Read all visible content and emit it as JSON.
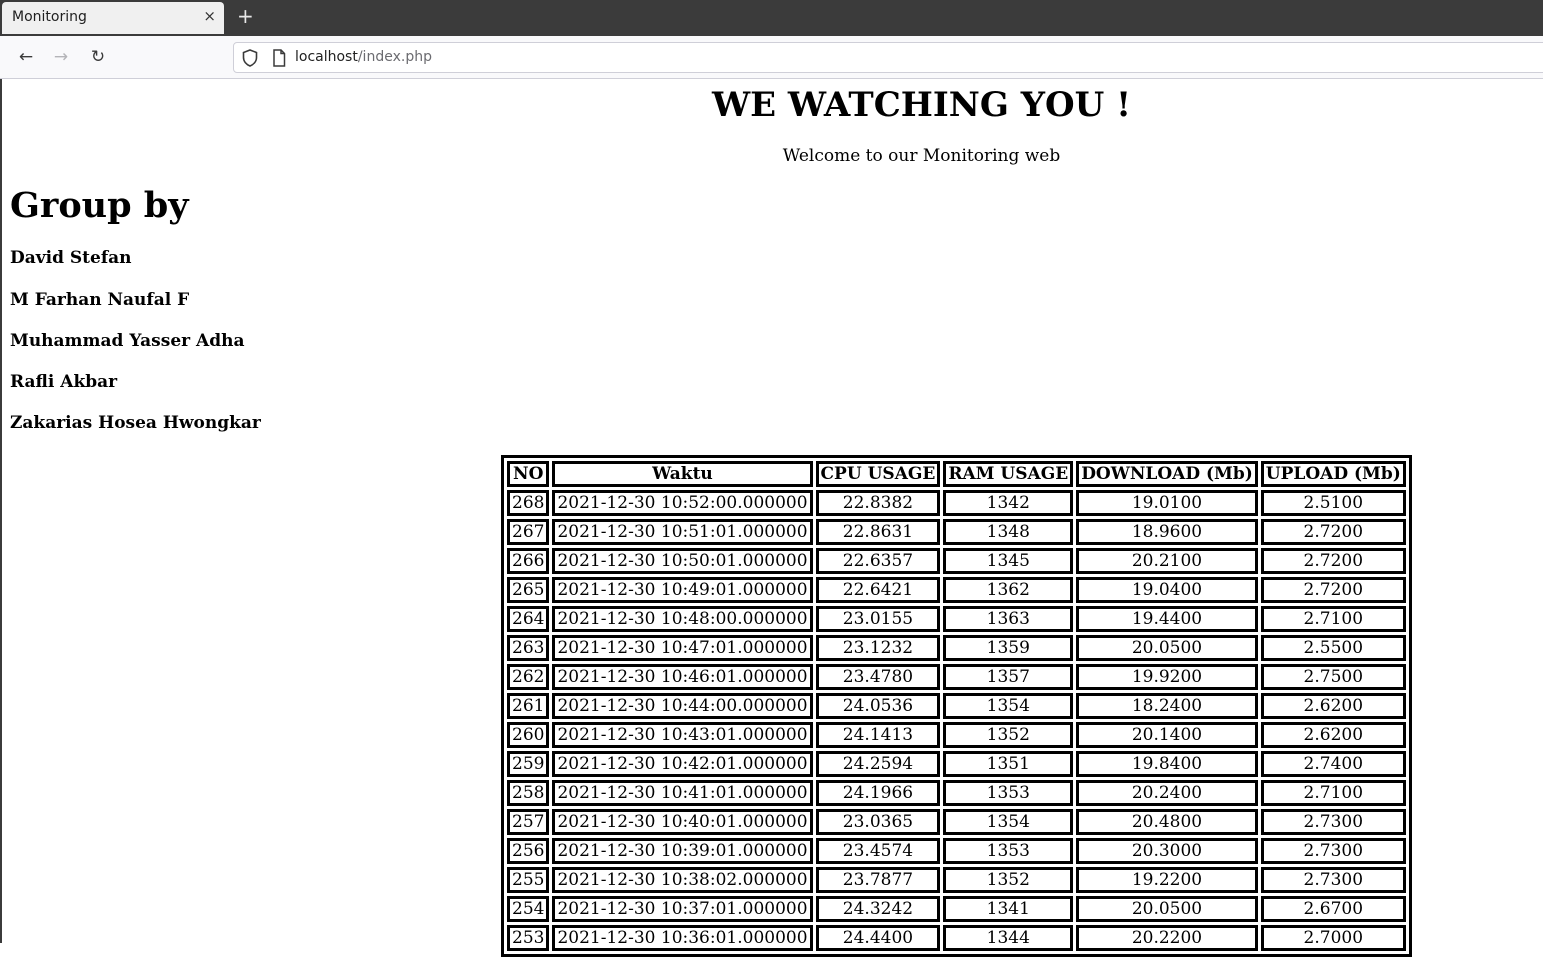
{
  "browser": {
    "tab_title": "Monitoring",
    "tab_close": "×",
    "new_tab": "+",
    "url_host": "localhost",
    "url_path": "/index.php",
    "back": "←",
    "forward": "→",
    "reload": "↻"
  },
  "page": {
    "title": "WE WATCHING YOU !",
    "subtitle": "Welcome to our Monitoring web",
    "group_heading": "Group by",
    "members": [
      "David Stefan",
      "M Farhan Naufal F",
      "Muhammad Yasser Adha",
      "Rafli Akbar",
      "Zakarias Hosea Hwongkar"
    ]
  },
  "table": {
    "headers": [
      "NO",
      "Waktu",
      "CPU USAGE",
      "RAM USAGE",
      "DOWNLOAD (Mb)",
      "UPLOAD (Mb)"
    ],
    "rows": [
      [
        "268",
        "2021-12-30 10:52:00.000000",
        "22.8382",
        "1342",
        "19.0100",
        "2.5100"
      ],
      [
        "267",
        "2021-12-30 10:51:01.000000",
        "22.8631",
        "1348",
        "18.9600",
        "2.7200"
      ],
      [
        "266",
        "2021-12-30 10:50:01.000000",
        "22.6357",
        "1345",
        "20.2100",
        "2.7200"
      ],
      [
        "265",
        "2021-12-30 10:49:01.000000",
        "22.6421",
        "1362",
        "19.0400",
        "2.7200"
      ],
      [
        "264",
        "2021-12-30 10:48:00.000000",
        "23.0155",
        "1363",
        "19.4400",
        "2.7100"
      ],
      [
        "263",
        "2021-12-30 10:47:01.000000",
        "23.1232",
        "1359",
        "20.0500",
        "2.5500"
      ],
      [
        "262",
        "2021-12-30 10:46:01.000000",
        "23.4780",
        "1357",
        "19.9200",
        "2.7500"
      ],
      [
        "261",
        "2021-12-30 10:44:00.000000",
        "24.0536",
        "1354",
        "18.2400",
        "2.6200"
      ],
      [
        "260",
        "2021-12-30 10:43:01.000000",
        "24.1413",
        "1352",
        "20.1400",
        "2.6200"
      ],
      [
        "259",
        "2021-12-30 10:42:01.000000",
        "24.2594",
        "1351",
        "19.8400",
        "2.7400"
      ],
      [
        "258",
        "2021-12-30 10:41:01.000000",
        "24.1966",
        "1353",
        "20.2400",
        "2.7100"
      ],
      [
        "257",
        "2021-12-30 10:40:01.000000",
        "23.0365",
        "1354",
        "20.4800",
        "2.7300"
      ],
      [
        "256",
        "2021-12-30 10:39:01.000000",
        "23.4574",
        "1353",
        "20.3000",
        "2.7300"
      ],
      [
        "255",
        "2021-12-30 10:38:02.000000",
        "23.7877",
        "1352",
        "19.2200",
        "2.7300"
      ],
      [
        "254",
        "2021-12-30 10:37:01.000000",
        "24.3242",
        "1341",
        "20.0500",
        "2.6700"
      ],
      [
        "253",
        "2021-12-30 10:36:01.000000",
        "24.4400",
        "1344",
        "20.2200",
        "2.7000"
      ]
    ]
  }
}
